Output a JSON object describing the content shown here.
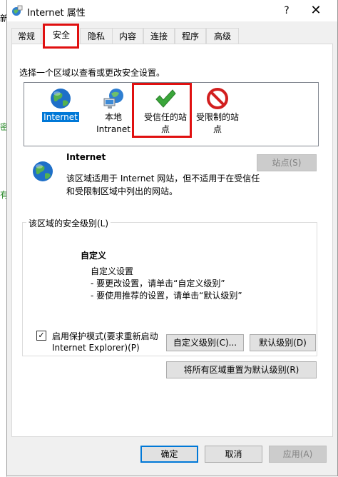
{
  "background": {
    "chars": [
      "新",
      "密",
      "有"
    ]
  },
  "window": {
    "title": "Internet 属性",
    "help": "?",
    "close": "✕"
  },
  "tabs": [
    "常规",
    "安全",
    "隐私",
    "内容",
    "连接",
    "程序",
    "高级"
  ],
  "active_tab": "安全",
  "security": {
    "instruction": "选择一个区域以查看或更改安全设置。",
    "zones": [
      {
        "label_line1": "Internet",
        "label_line2": "",
        "icon": "globe-icon",
        "selected": true
      },
      {
        "label_line1": "本地",
        "label_line2": "Intranet",
        "icon": "intranet-icon",
        "selected": false
      },
      {
        "label_line1": "受信任的站",
        "label_line2": "点",
        "icon": "checkmark-icon",
        "selected": false
      },
      {
        "label_line1": "受限制的站",
        "label_line2": "点",
        "icon": "restricted-icon",
        "selected": false
      }
    ],
    "zone_title": "Internet",
    "zone_desc_line1": "该区域适用于 Internet 网站，但不适用于在受信任",
    "zone_desc_line2": "和受限制区域中列出的网站。",
    "sites_button": "站点(S)",
    "level_group_title": "该区域的安全级别(L)",
    "level_name": "自定义",
    "level_lines": [
      "自定义设置",
      "- 要更改设置，请单击“自定义级别”",
      "- 要使用推荐的设置，请单击“默认级别”"
    ],
    "protected_mode_line1": "启用保护模式(要求重新启动",
    "protected_mode_line2": "Internet Explorer)(P)",
    "protected_mode_checked": true,
    "custom_level_button": "自定义级别(C)...",
    "default_level_button": "默认级别(D)",
    "reset_all_button": "将所有区域重置为默认级别(R)"
  },
  "footer": {
    "ok": "确定",
    "cancel": "取消",
    "apply": "应用(A)"
  },
  "colors": {
    "selection": "#0078d7",
    "highlight_box": "#e01010",
    "check_green": "#3aa63a",
    "restricted_red": "#d21f1f"
  }
}
